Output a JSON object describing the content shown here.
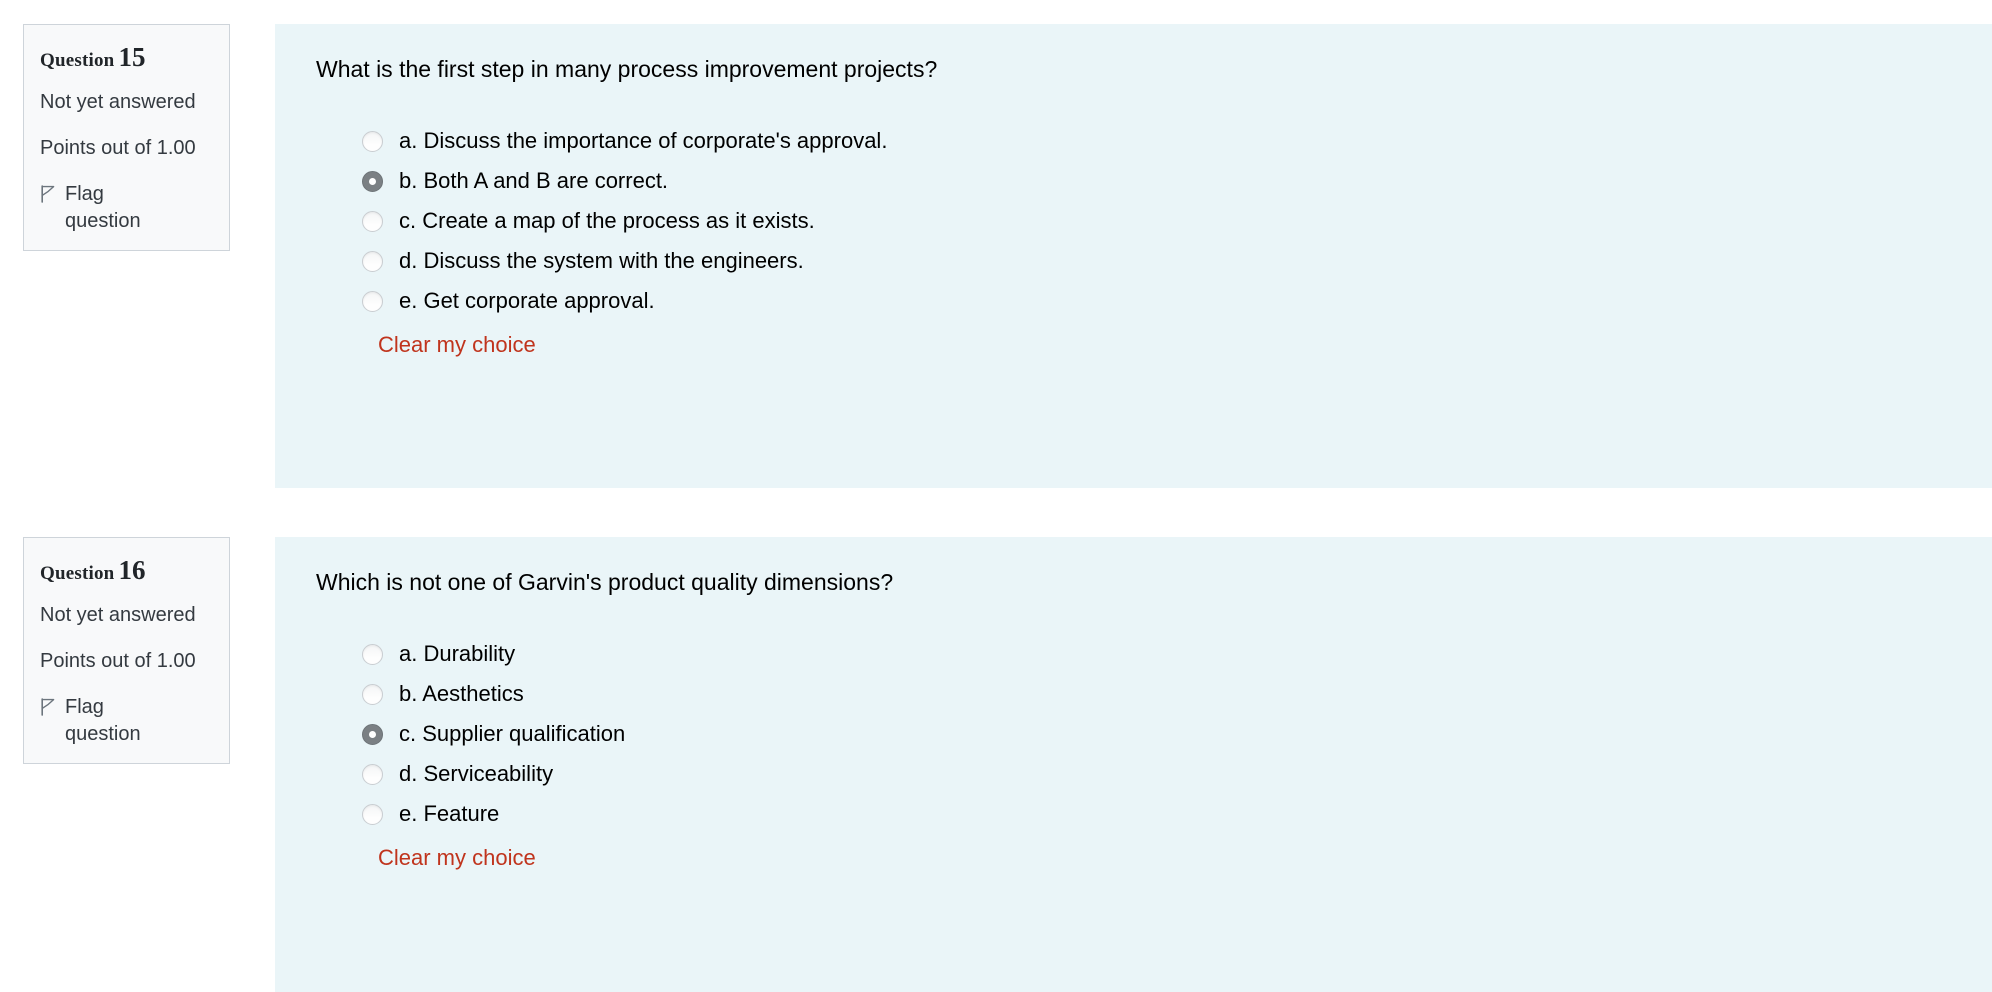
{
  "theme": {
    "panel_bg": "#eaf5f8",
    "info_bg": "#f8f9fa",
    "info_border": "#ced4da",
    "link_color": "#c0341d",
    "text_color": "#000000",
    "muted_text": "#343a40",
    "radio_selected": "#7b8084"
  },
  "questions": [
    {
      "info": {
        "header_word": "Question",
        "header_number": "15",
        "state": "Not yet answered",
        "points": "Points out of 1.00",
        "flag_label": "Flag question",
        "flag_icon": "flag-icon"
      },
      "prompt": "What is the first step in many process improvement projects?",
      "options": [
        {
          "label": "a. Discuss the importance of corporate's approval.",
          "selected": false
        },
        {
          "label": "b. Both A and B are correct.",
          "selected": true
        },
        {
          "label": "c. Create a map of the process as it exists.",
          "selected": false
        },
        {
          "label": "d. Discuss the system with the engineers.",
          "selected": false
        },
        {
          "label": "e. Get corporate approval.",
          "selected": false
        }
      ],
      "clear_label": "Clear my choice"
    },
    {
      "info": {
        "header_word": "Question",
        "header_number": "16",
        "state": "Not yet answered",
        "points": "Points out of 1.00",
        "flag_label": "Flag question",
        "flag_icon": "flag-icon"
      },
      "prompt": "Which is not one of Garvin's product quality dimensions?",
      "options": [
        {
          "label": "a. Durability",
          "selected": false
        },
        {
          "label": "b. Aesthetics",
          "selected": false
        },
        {
          "label": "c. Supplier qualification",
          "selected": true
        },
        {
          "label": "d. Serviceability",
          "selected": false
        },
        {
          "label": "e. Feature",
          "selected": false
        }
      ],
      "clear_label": "Clear my choice"
    }
  ]
}
